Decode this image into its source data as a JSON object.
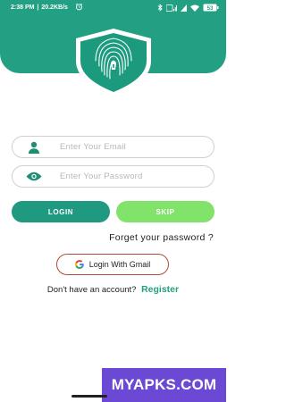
{
  "status_bar": {
    "time": "2:38 PM",
    "speed": "20.2KB/s",
    "battery": "53"
  },
  "login_form": {
    "email_placeholder": "Enter Your Email",
    "password_placeholder": "Enter Your Password",
    "login_label": "LOGIN",
    "skip_label": "SKIP",
    "forgot_label": "Forget your password ?",
    "gmail_label": "Login With Gmail",
    "no_account_text": "Don't have an account?",
    "register_label": "Register"
  },
  "watermark": {
    "text": "MYAPKS.COM"
  },
  "colors": {
    "brand_green": "#23a083",
    "skip_green": "#82e36a",
    "gmail_border": "#b5483a",
    "watermark_purple": "#6b49d4"
  },
  "icons": [
    "alarm-icon",
    "bluetooth-icon",
    "signal-icon",
    "wifi-icon",
    "battery-icon",
    "fingerprint-shield-icon",
    "user-icon",
    "eye-icon",
    "google-icon"
  ]
}
